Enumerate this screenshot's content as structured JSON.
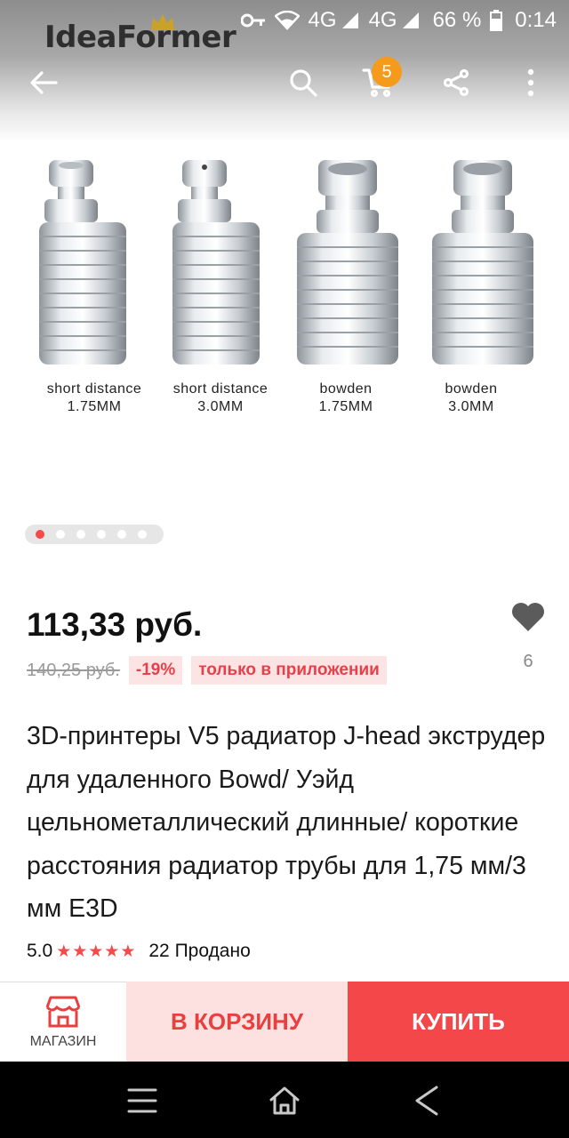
{
  "status_bar": {
    "network1": "4G",
    "network2": "4G",
    "battery": "66 %",
    "time": "0:14"
  },
  "header": {
    "brand_logo_text": "IdeaFormer",
    "cart_count": "5",
    "icons": [
      "back-arrow-icon",
      "search-icon",
      "cart-icon",
      "share-icon",
      "more-vert-icon"
    ]
  },
  "gallery": {
    "items": [
      {
        "line1": "short distance",
        "line2": "1.75MM"
      },
      {
        "line1": "short distance",
        "line2": "3.0MM"
      },
      {
        "line1": "bowden",
        "line2": "1.75MM"
      },
      {
        "line1": "bowden",
        "line2": "3.0MM"
      }
    ],
    "total_images": 6,
    "active_index": 0
  },
  "product": {
    "price": "113,33 руб.",
    "old_price": "140,25 руб.",
    "discount": "-19%",
    "app_only_tag": "только в приложении",
    "favorites_count": "6",
    "title": "3D-принтеры V5 радиатор J-head экструдер для удаленного Bowd/ Уэйд цельнометаллический длинные/ короткие расстояния радиатор трубы для 1,75 мм/3 мм E3D",
    "rating": "5.0",
    "stars": "★★★★★",
    "sold": "22 Продано"
  },
  "actions": {
    "shop_label": "МАГАЗИН",
    "add_to_cart": "В КОРЗИНУ",
    "buy": "КУПИТЬ"
  },
  "colors": {
    "accent": "#f4474a",
    "accent_light": "#fde0e0",
    "badge": "#f59a1b"
  }
}
